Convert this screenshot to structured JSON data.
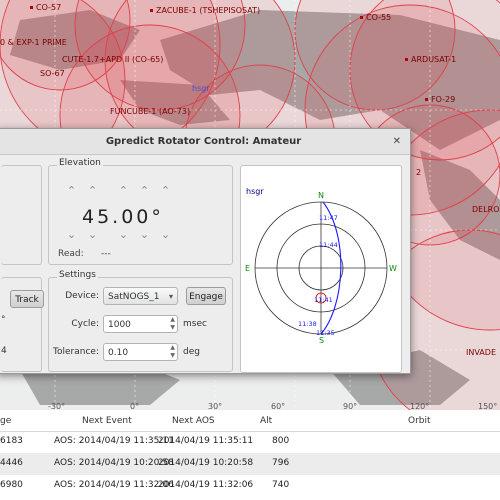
{
  "map": {
    "qth": "hsgr",
    "satellites": [
      {
        "name": "CO-57"
      },
      {
        "name": "ZACUBE-1 (TSHEPISOSAT)"
      },
      {
        "name": "CO-55"
      },
      {
        "name": "0 & EXP-1 PRIME"
      },
      {
        "name": "ARDUSAT-1"
      },
      {
        "name": "CUTE-1.7+APD II (CO-65)"
      },
      {
        "name": "SO-67"
      },
      {
        "name": "FO-29"
      },
      {
        "name": "FUNCUBE-1 (AO-73)"
      },
      {
        "name": "2"
      },
      {
        "name": "DELRO"
      },
      {
        "name": "INVADE"
      }
    ],
    "lon_ticks": [
      "-30°",
      "0°",
      "30°",
      "60°",
      "90°",
      "120°",
      "150°"
    ]
  },
  "dialog": {
    "title": "Gpredict Rotator Control: Amateur",
    "close_icon": "close-icon",
    "elevation": {
      "title": "Elevation",
      "value": "45.00°",
      "read_label": "Read:",
      "read_value": "---"
    },
    "settings": {
      "title": "Settings",
      "device_label": "Device:",
      "device_value": "SatNOGS_1",
      "engage_label": "Engage",
      "cycle_label": "Cycle:",
      "cycle_value": "1000",
      "cycle_unit": "msec",
      "tolerance_label": "Tolerance:",
      "tolerance_value": "0.10",
      "tolerance_unit": "deg"
    },
    "track_label": "Track",
    "left_stub_1": "°",
    "left_stub_2": "4",
    "polar": {
      "qth": "hsgr",
      "north": "N",
      "south": "S",
      "east": "E",
      "west": "W",
      "times": [
        "11:47",
        "11:44",
        "11:41",
        "11:38",
        "11:35"
      ]
    }
  },
  "table": {
    "columns": [
      "ge",
      "Next Event",
      "Next AOS",
      "Alt",
      "Orbit"
    ],
    "rows": [
      {
        "range": "6183",
        "next_event": "AOS: 2014/04/19 11:35:11",
        "next_aos": "2014/04/19 11:35:11",
        "alt": "800",
        "orbit": ""
      },
      {
        "range": "4446",
        "next_event": "AOS: 2014/04/19 10:20:58",
        "next_aos": "2014/04/19 10:20:58",
        "alt": "796",
        "orbit": ""
      },
      {
        "range": "6980",
        "next_event": "AOS: 2014/04/19 11:32:06",
        "next_aos": "2014/04/19 11:32:06",
        "alt": "740",
        "orbit": ""
      }
    ]
  },
  "colors": {
    "footprint": "#e0404a",
    "satellite_label": "#7a0000",
    "qth": "#4d4dcc",
    "track": "#1a1aff",
    "compass": "#0a8a0a"
  }
}
